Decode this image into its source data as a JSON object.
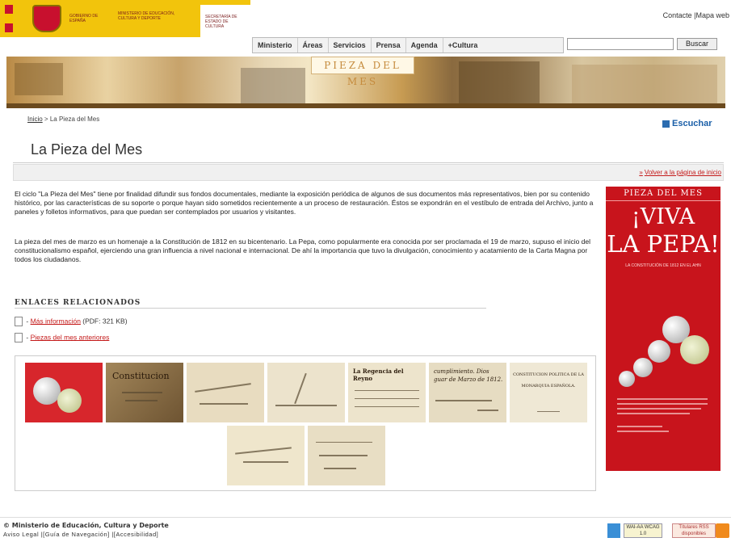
{
  "header": {
    "gov_name": "GOBIERNO DE ESPAÑA",
    "ministry_name": "MINISTERIO DE EDUCACIÓN, CULTURA Y DEPORTE",
    "secretariat_name": "SECRETARÍA DE ESTADO DE CULTURA",
    "top_links": {
      "contact": "Contacte",
      "sitemap": "Mapa web"
    },
    "nav": [
      "Ministerio",
      "Áreas",
      "Servicios",
      "Prensa",
      "Agenda",
      "+Cultura"
    ],
    "search": {
      "value": "",
      "button": "Buscar"
    },
    "banner_title": "PIEZA DEL MES"
  },
  "breadcrumb": {
    "home": "Inicio",
    "sep": ">",
    "current": "La Pieza del Mes"
  },
  "listen": "Escuchar",
  "page_title": "La Pieza del Mes",
  "back_link": "Volver a la página de inicio",
  "paragraphs": [
    "El ciclo \"La Pieza del Mes\" tiene por finalidad difundir sus fondos documentales, mediante la exposición periódica de algunos de sus documentos más representativos, bien por su contenido histórico, por las características de su soporte o porque hayan sido sometidos recientemente a un proceso de restauración. Éstos se expondrán en el vestíbulo de entrada del Archivo, junto a paneles y folletos informativos, para que puedan ser contemplados por usuarios y visitantes.",
    "La pieza del mes de marzo es un homenaje a la Constitución de 1812 en su bicentenario. La Pepa, como popularmente era conocida por ser proclamada el 19 de marzo, supuso el inicio del constitucionalismo español, ejerciendo una gran influencia a nivel nacional e internacional. De ahí la importancia que tuvo la divulgación, conocimiento y acatamiento de la Carta Magna por todos los ciudadanos."
  ],
  "related": {
    "heading": "ENLACES RELACIONADOS",
    "items": [
      {
        "link": "Más información",
        "suffix": " (PDF: 321 KB)"
      },
      {
        "link": "Piezas del mes anteriores",
        "suffix": ""
      }
    ]
  },
  "gallery": {
    "thumbs": [
      {
        "caption": ""
      },
      {
        "caption": "Constitucion"
      },
      {
        "caption": ""
      },
      {
        "caption": ""
      },
      {
        "caption": "La Regencia del Reyno"
      },
      {
        "caption": "cumplimiento. Dios guar de Marzo de 1812."
      },
      {
        "caption": "CONSTITUCION POLITICA DE LA MONARQUIA ESPAÑOLA."
      },
      {
        "caption": ""
      },
      {
        "caption": ""
      }
    ]
  },
  "poster": {
    "head": "PIEZA DEL MES",
    "line1": "¡VIVA",
    "line2": "LA PEPA!",
    "sub": "LA CONSTITUCIÓN DE 1812 EN EL AHN"
  },
  "footer": {
    "copyright": "© Ministerio de Educación, Cultura y Deporte",
    "links": [
      "Aviso Legal",
      "Guía de Navegación",
      "Accesibilidad"
    ],
    "badges": {
      "wai": "WAI-AA WCAG 1.0",
      "rss": "Títulares RSS disponibles"
    }
  },
  "colors": {
    "link_red": "#c41a1a",
    "poster_red": "#c8141c",
    "gov_yellow": "#f2c40c",
    "listen_blue": "#1b5fa8"
  }
}
